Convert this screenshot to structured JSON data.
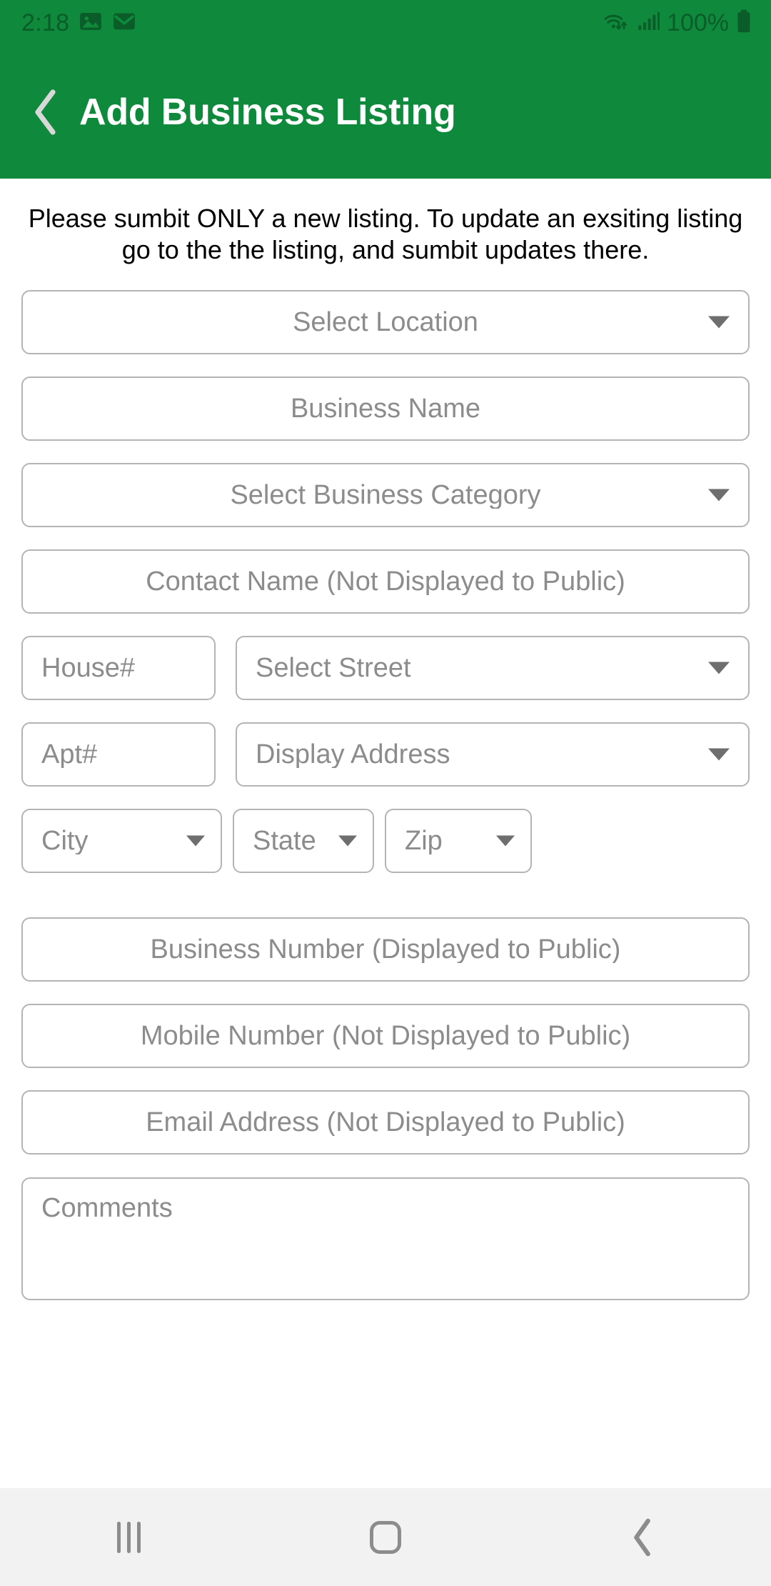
{
  "status_bar": {
    "time": "2:18",
    "battery_percent": "100%",
    "icons": [
      "gallery-icon",
      "email-icon",
      "wifi-icon",
      "cellular-signal-icon",
      "battery-icon"
    ]
  },
  "app_bar": {
    "title": "Add Business Listing",
    "back_label": "Back"
  },
  "notice": {
    "text": "Please sumbit ONLY a new listing. To update an exsiting listing go to the the listing, and sumbit updates there."
  },
  "form": {
    "location": {
      "placeholder": "Select Location",
      "type": "dropdown"
    },
    "business_name": {
      "placeholder": "Business Name",
      "type": "text"
    },
    "business_category": {
      "placeholder": "Select Business Category",
      "type": "dropdown"
    },
    "contact_name": {
      "placeholder": "Contact Name (Not Displayed to Public)",
      "type": "text"
    },
    "house_number": {
      "placeholder": "House#",
      "type": "text"
    },
    "street": {
      "placeholder": "Select Street",
      "type": "dropdown"
    },
    "apt_number": {
      "placeholder": "Apt#",
      "type": "text"
    },
    "display_address": {
      "placeholder": "Display Address",
      "type": "dropdown"
    },
    "city": {
      "placeholder": "City",
      "type": "dropdown"
    },
    "state": {
      "placeholder": "State",
      "type": "dropdown"
    },
    "zip": {
      "placeholder": "Zip",
      "type": "dropdown"
    },
    "business_number": {
      "placeholder": "Business Number (Displayed to Public)",
      "type": "text"
    },
    "mobile_number": {
      "placeholder": "Mobile Number (Not Displayed to Public)",
      "type": "text"
    },
    "email_address": {
      "placeholder": "Email Address (Not Displayed to Public)",
      "type": "text"
    },
    "comments": {
      "placeholder": "Comments",
      "type": "textarea"
    }
  },
  "nav_bar": {
    "recents_label": "Recents",
    "home_label": "Home",
    "back_label": "Back"
  },
  "colors": {
    "brand_green": "#0f8a3c",
    "status_icon_green": "#0a5c28",
    "field_border": "#b4b4b4",
    "placeholder_text": "#8c8c8c",
    "nav_background": "#f2f2f2",
    "nav_icon": "#8c8c8c"
  }
}
